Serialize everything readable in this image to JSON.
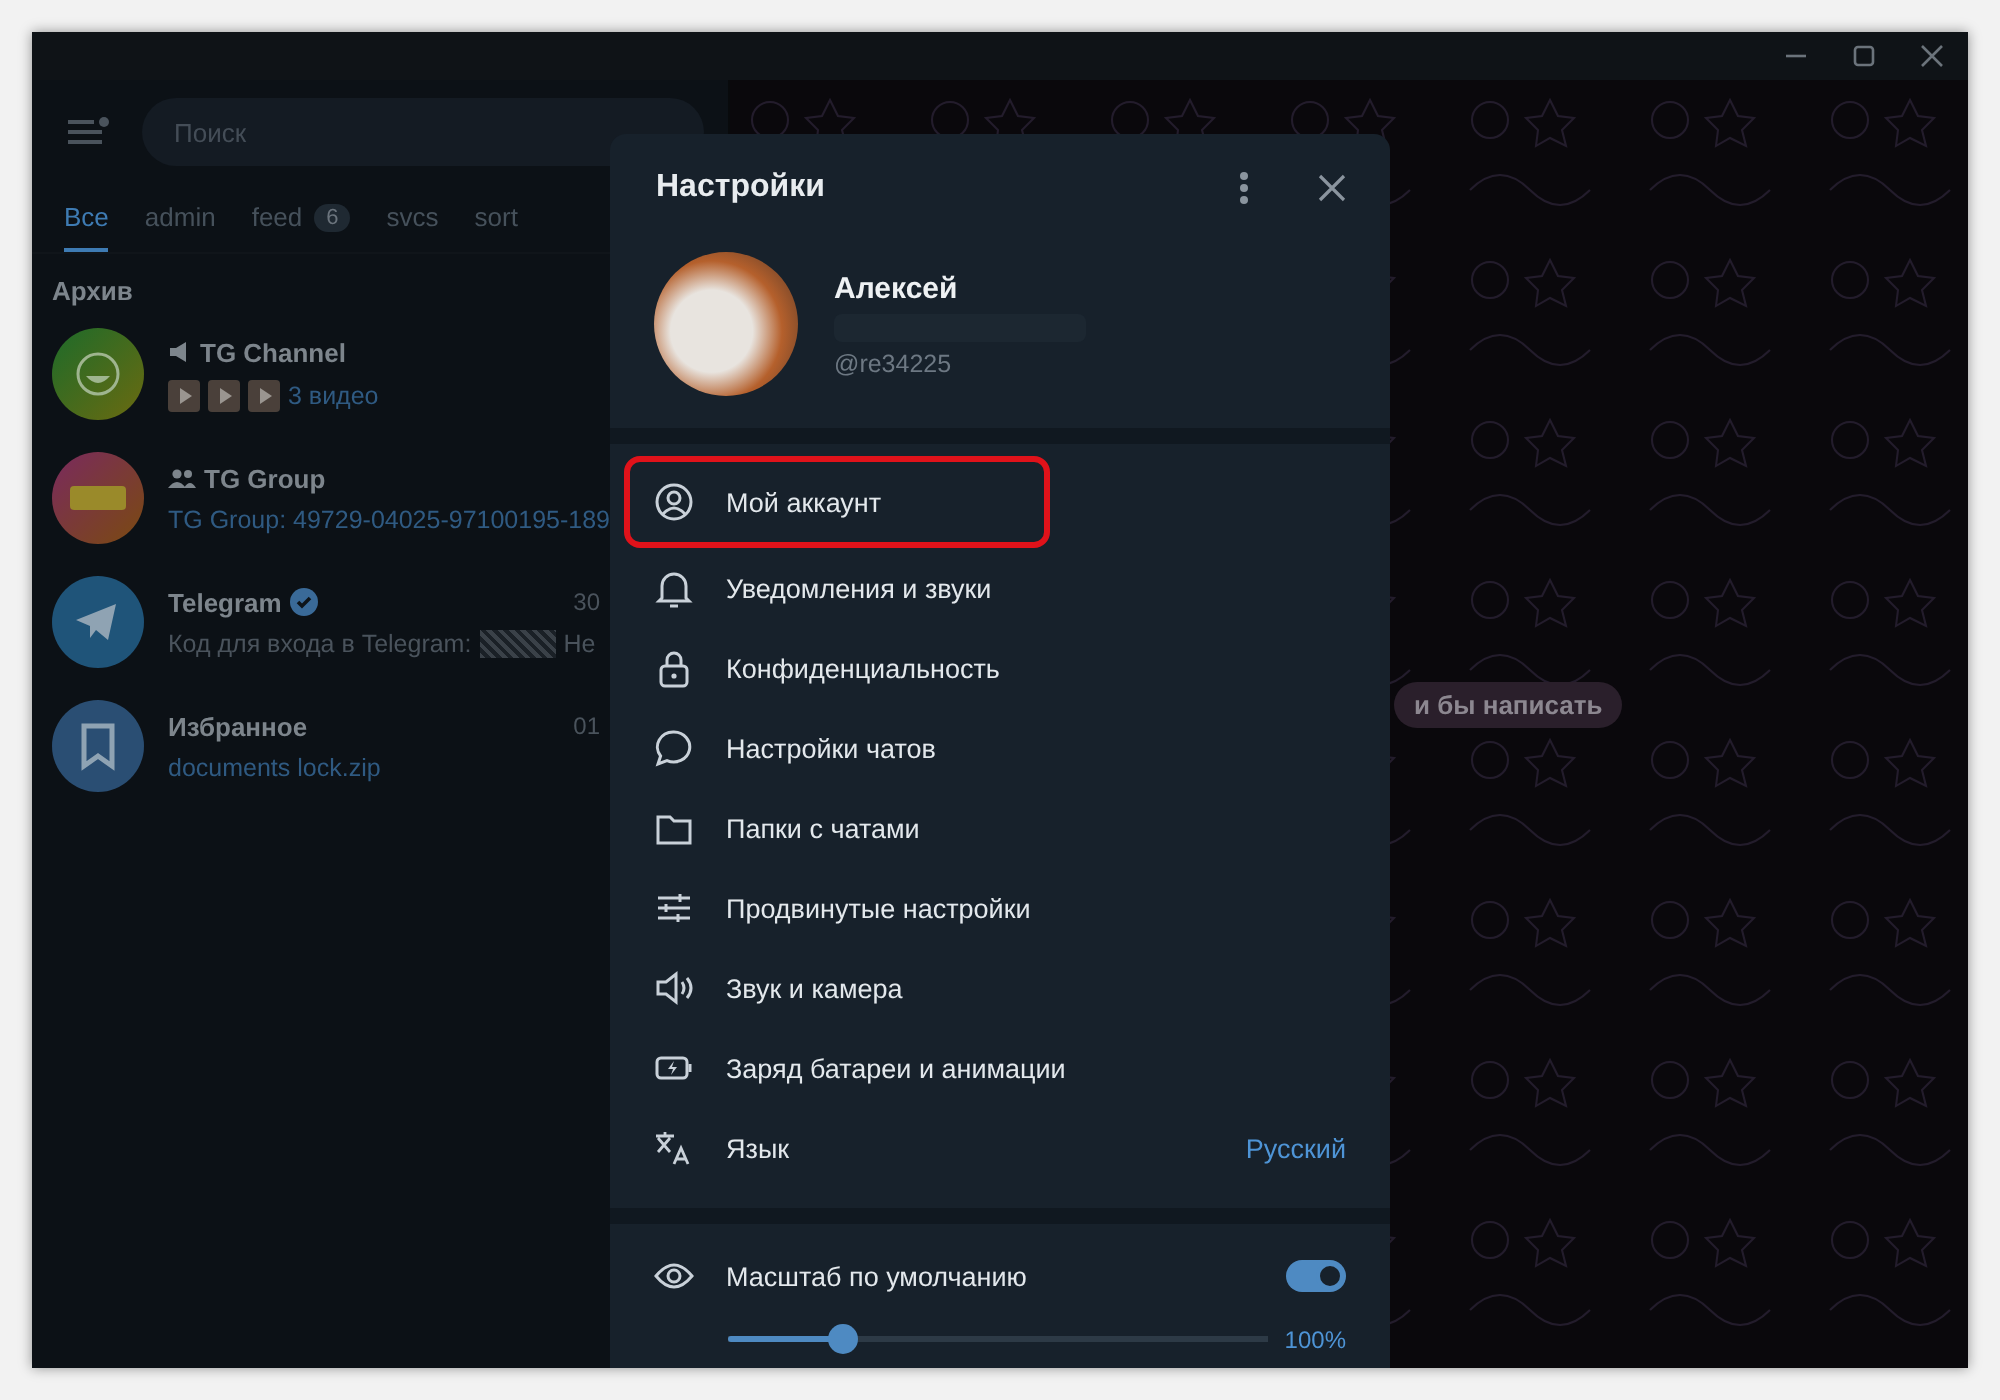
{
  "sidebar": {
    "search": {
      "placeholder": "Поиск"
    },
    "folders": [
      {
        "label": "Все",
        "selected": true
      },
      {
        "label": "admin",
        "selected": false
      },
      {
        "label": "feed",
        "badge": "6",
        "selected": false
      },
      {
        "label": "svcs",
        "selected": false
      },
      {
        "label": "sort",
        "selected": false
      }
    ],
    "section_title": "Архив",
    "chats": [
      {
        "kind": "channel",
        "name": "TG Channel",
        "media": [
          {
            "kind": "video"
          },
          {
            "kind": "video"
          },
          {
            "kind": "video"
          }
        ],
        "preview": "3 видео"
      },
      {
        "kind": "group",
        "name": "TG Group",
        "preview": "TG Group: 49729-04025-97100195-189"
      },
      {
        "kind": "service",
        "name": "Telegram",
        "verified": true,
        "time": "30",
        "preview": "Код для входа в Telegram:",
        "spoiler": true,
        "preview_end": "Не"
      },
      {
        "kind": "saved",
        "name": "Избранное",
        "time": "01",
        "preview": "documents lock.zip"
      }
    ]
  },
  "chat": {
    "hint": "и бы написать"
  },
  "settings": {
    "title": "Настройки",
    "profile": {
      "name": "Алексей",
      "username": "@re34225"
    },
    "items": [
      {
        "kind": "account",
        "label": "Мой аккаунт",
        "highlighted": true
      },
      {
        "kind": "notifications",
        "label": "Уведомления и звуки",
        "highlighted": false
      },
      {
        "kind": "privacy",
        "label": "Конфиденциальность",
        "highlighted": false
      },
      {
        "kind": "chats",
        "label": "Настройки чатов",
        "highlighted": false
      },
      {
        "kind": "folders",
        "label": "Папки с чатами",
        "highlighted": false
      },
      {
        "kind": "advanced",
        "label": "Продвинутые настройки",
        "highlighted": false
      },
      {
        "kind": "sound",
        "label": "Звук и камера",
        "highlighted": false
      },
      {
        "kind": "battery",
        "label": "Заряд батареи и анимации",
        "highlighted": false
      },
      {
        "kind": "language",
        "label": "Язык",
        "value": "Русский",
        "highlighted": false
      }
    ],
    "scale": {
      "label": "Масштаб по умолчанию",
      "on": true,
      "level": 0.21,
      "reading": "100%"
    }
  }
}
